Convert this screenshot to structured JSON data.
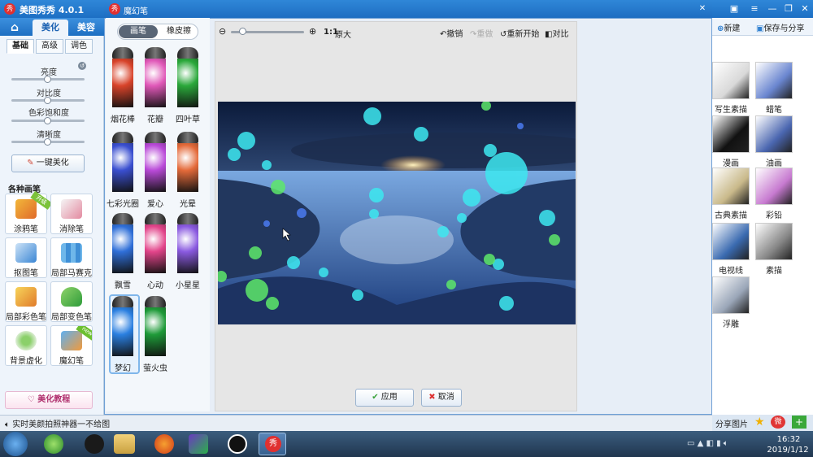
{
  "app": {
    "title": "美图秀秀 4.0.1",
    "logo_char": "秀"
  },
  "nav": {
    "tabs": [
      "美化",
      "美容"
    ]
  },
  "left": {
    "sub_tabs": [
      "基础",
      "高级",
      "调色"
    ],
    "sliders": [
      {
        "label": "亮度",
        "value": 0.45
      },
      {
        "label": "对比度",
        "value": 0.45
      },
      {
        "label": "色彩饱和度",
        "value": 0.45
      },
      {
        "label": "清晰度",
        "value": 0.45
      }
    ],
    "one_click": "一键美化",
    "brushes_title": "各种画笔",
    "tools": [
      {
        "label": "涂鸦笔",
        "icon": "pencil-icon",
        "badge": "升级"
      },
      {
        "label": "消除笔",
        "icon": "eraser-icon",
        "badge": ""
      },
      {
        "label": "抠图笔",
        "icon": "cutout-pen-icon",
        "badge": ""
      },
      {
        "label": "局部马赛克",
        "icon": "mosaic-icon",
        "badge": ""
      },
      {
        "label": "局部彩色笔",
        "icon": "color-brush-icon",
        "badge": ""
      },
      {
        "label": "局部变色笔",
        "icon": "color-change-bucket-icon",
        "badge": ""
      },
      {
        "label": "背景虚化",
        "icon": "blur-icon",
        "badge": ""
      },
      {
        "label": "魔幻笔",
        "icon": "magic-pen-icon",
        "badge": "new"
      }
    ],
    "tutorial": "美化教程"
  },
  "dialog": {
    "title": "魔幻笔",
    "mode_tabs": [
      "画笔",
      "橡皮擦"
    ],
    "brushes": [
      {
        "label": "烟花棒",
        "color": "#d8432a"
      },
      {
        "label": "花瓣",
        "color": "#e058b8"
      },
      {
        "label": "四叶草",
        "color": "#2aa83a"
      },
      {
        "label": "七彩光圈",
        "color": "#3a4fd0"
      },
      {
        "label": "爱心",
        "color": "#b94ad8"
      },
      {
        "label": "光晕",
        "color": "#e46a3a"
      },
      {
        "label": "飘雪",
        "color": "#2f6fd8"
      },
      {
        "label": "心动",
        "color": "#e2448a"
      },
      {
        "label": "小星星",
        "color": "#8a5ae0"
      },
      {
        "label": "梦幻",
        "color": "#2a7fe0"
      },
      {
        "label": "萤火虫",
        "color": "#1e9a38"
      }
    ],
    "zoom_label": "1:1",
    "original_size": "原大",
    "undo": "撤销",
    "redo": "重做",
    "restart": "重新开始",
    "compare": "对比",
    "apply": "应用",
    "cancel": "取消"
  },
  "right": {
    "new": "新建",
    "save_share": "保存与分享",
    "effects": [
      "写生素描",
      "蜡笔",
      "漫画",
      "油画",
      "古典素描",
      "彩铅",
      "电视线",
      "素描",
      "浮雕"
    ],
    "share_image": "分享图片"
  },
  "status": {
    "text": "实时美颜拍照神器一不给图"
  },
  "taskbar": {
    "time": "16:32",
    "date": "2019/1/12"
  }
}
